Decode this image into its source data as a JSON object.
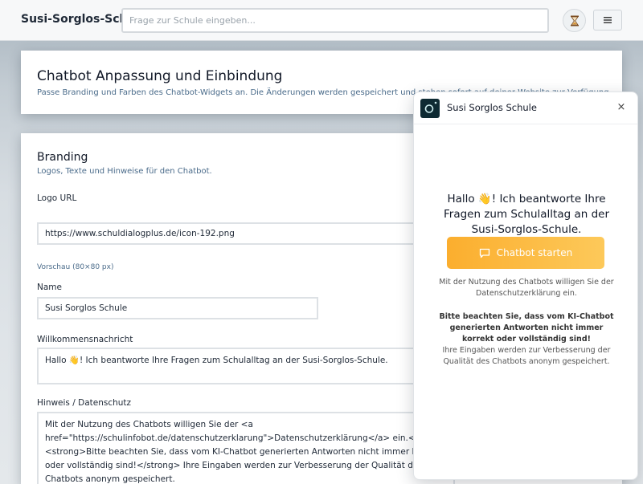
{
  "topbar": {
    "brand": "Susi-Sorglos-Schule",
    "search_placeholder": "Frage zur Schule eingeben...",
    "hourglass_icon": "⌛",
    "menu_icon": "☰"
  },
  "header_card": {
    "title": "Chatbot Anpassung und Einbindung",
    "subtitle": "Passe Branding und Farben des Chatbot-Widgets an. Die Änderungen werden gespeichert und stehen sofort auf deiner Website zur Verfügung."
  },
  "branding_card": {
    "title": "Branding",
    "subtitle": "Logos, Texte und Hinweise für den Chatbot.",
    "logo_url_label": "Logo URL",
    "logo_url_value": "https://www.schuldialogplus.de/icon-192.png",
    "preview_hint": "Vorschau (80×80 px)",
    "name_label": "Name",
    "name_value": "Susi Sorglos Schule",
    "welcome_label": "Willkommensnachricht",
    "welcome_value": "Hallo 👋! Ich beantworte Ihre Fragen zum Schulalltag an der Susi-Sorglos-Schule.",
    "privacy_label": "Hinweis / Datenschutz",
    "privacy_value": "Mit der Nutzung des Chatbots willigen Sie der <a href=\"https://schulinfobot.de/datenschutzerklarung\">Datenschutzerklärung</a> ein.<br /><strong>Bitte beachten Sie, dass vom KI-Chatbot generierten Antworten nicht immer korrekt oder vollständig sind!</strong> Ihre Eingaben werden zur Verbesserung der Qualität des Chatbots anonym gespeichert."
  },
  "chat_widget": {
    "title": "Susi Sorglos Schule",
    "close_icon": "×",
    "welcome": "Hallo 👋! Ich beantworte Ihre Fragen zum Schulalltag an der Susi-Sorglos-Schule.",
    "start_button": "Chatbot starten",
    "note": "Mit der Nutzung des Chatbots willigen Sie der Datenschutzerklärung ein.",
    "warning_bold": "Bitte beachten Sie, dass vom KI-Chatbot generierten Antworten nicht immer korrekt oder vollständig sind!",
    "warning_text": "Ihre Eingaben werden zur Verbesserung der Qualität des Chatbots anonym gespeichert.",
    "accent_color": "#fbae2e"
  }
}
